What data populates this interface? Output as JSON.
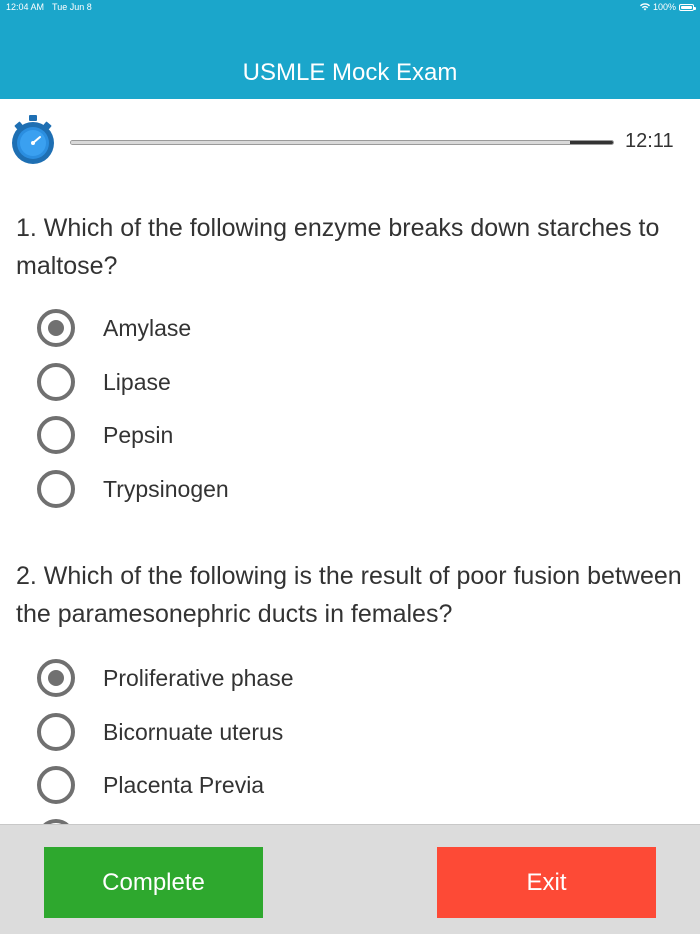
{
  "status_bar": {
    "time": "12:04 AM",
    "date": "Tue Jun 8",
    "battery": "100%",
    "wifi_icon": "wifi-icon",
    "battery_icon": "battery-icon"
  },
  "header": {
    "title": "USMLE Mock Exam",
    "color": "#1ba6cb"
  },
  "timer": {
    "icon": "stopwatch-icon",
    "time": "12:11",
    "remaining_fraction": 0.92
  },
  "questions": [
    {
      "text": "1. Which of the following enzyme breaks down starches to maltose?",
      "options": [
        {
          "label": "Amylase",
          "selected": true
        },
        {
          "label": "Lipase",
          "selected": false
        },
        {
          "label": "Pepsin",
          "selected": false
        },
        {
          "label": "Trypsinogen",
          "selected": false
        }
      ]
    },
    {
      "text": "2. Which of the following is the result of poor fusion between the paramesonephric ducts in females?",
      "options": [
        {
          "label": "Proliferative phase",
          "selected": true
        },
        {
          "label": "Bicornuate uterus",
          "selected": false
        },
        {
          "label": "Placenta Previa",
          "selected": false
        },
        {
          "label": "",
          "selected": false
        }
      ]
    }
  ],
  "footer": {
    "complete_label": "Complete",
    "exit_label": "Exit",
    "complete_color": "#2ea82e",
    "exit_color": "#fd4a36"
  }
}
